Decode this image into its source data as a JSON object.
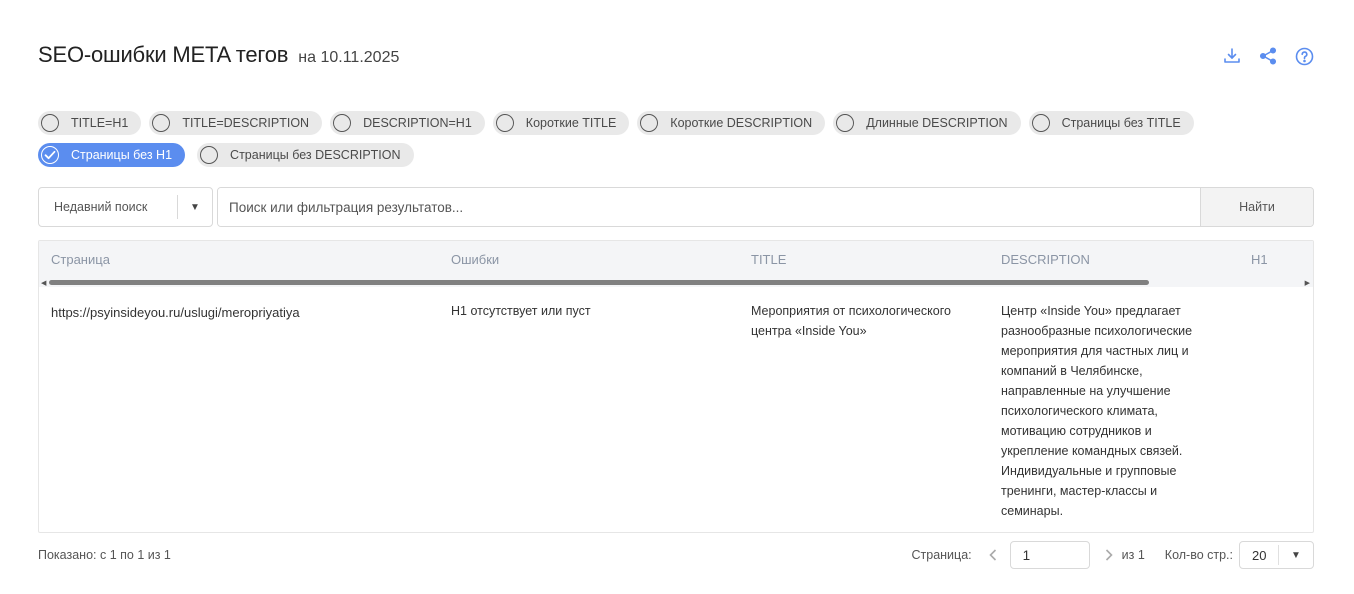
{
  "header": {
    "title": "SEO-ошибки META тегов",
    "date_label": "на 10.11.2025"
  },
  "header_icons": [
    "download-icon",
    "share-icon",
    "help-icon"
  ],
  "filters": [
    {
      "label": "TITLE=H1",
      "active": false
    },
    {
      "label": "TITLE=DESCRIPTION",
      "active": false
    },
    {
      "label": "DESCRIPTION=H1",
      "active": false
    },
    {
      "label": "Короткие TITLE",
      "active": false
    },
    {
      "label": "Короткие DESCRIPTION",
      "active": false
    },
    {
      "label": "Длинные DESCRIPTION",
      "active": false
    },
    {
      "label": "Страницы без TITLE",
      "active": false
    },
    {
      "label": "Страницы без H1",
      "active": true
    },
    {
      "label": "Страницы без DESCRIPTION",
      "active": false
    }
  ],
  "search": {
    "recent_label": "Недавний поиск",
    "placeholder": "Поиск или фильтрация результатов...",
    "value": "",
    "button_label": "Найти"
  },
  "table": {
    "columns": [
      "Страница",
      "Ошибки",
      "TITLE",
      "DESCRIPTION",
      "H1"
    ],
    "rows": [
      {
        "page": "https://psyinsideyou.ru/uslugi/meropriyatiya",
        "errors": "H1 отсутствует или пуст",
        "title_lines": [
          "Мероприятия от психологического",
          "центра «Inside You»"
        ],
        "description_lines": [
          "Центр «Inside You» предлагает",
          "разнообразные психологические",
          "мероприятия для частных лиц и",
          "компаний в Челябинске,",
          "направленные на улучшение",
          "психологического климата,",
          "мотивацию сотрудников и",
          "укрепление командных связей.",
          "Индивидуальные и групповые",
          "тренинги, мастер-классы и",
          "семинары."
        ],
        "h1": ""
      }
    ]
  },
  "footer": {
    "shown_label": "Показано: с 1 по 1 из 1",
    "page_label": "Страница:",
    "page_value": "1",
    "of_total": "из 1",
    "per_page_label": "Кол-во стр.:",
    "per_page_value": "20"
  },
  "colors": {
    "accent": "#5b8def",
    "chip_bg": "#e9e9e9",
    "header_bg": "#f4f5f7",
    "icon": "#5b8def"
  }
}
